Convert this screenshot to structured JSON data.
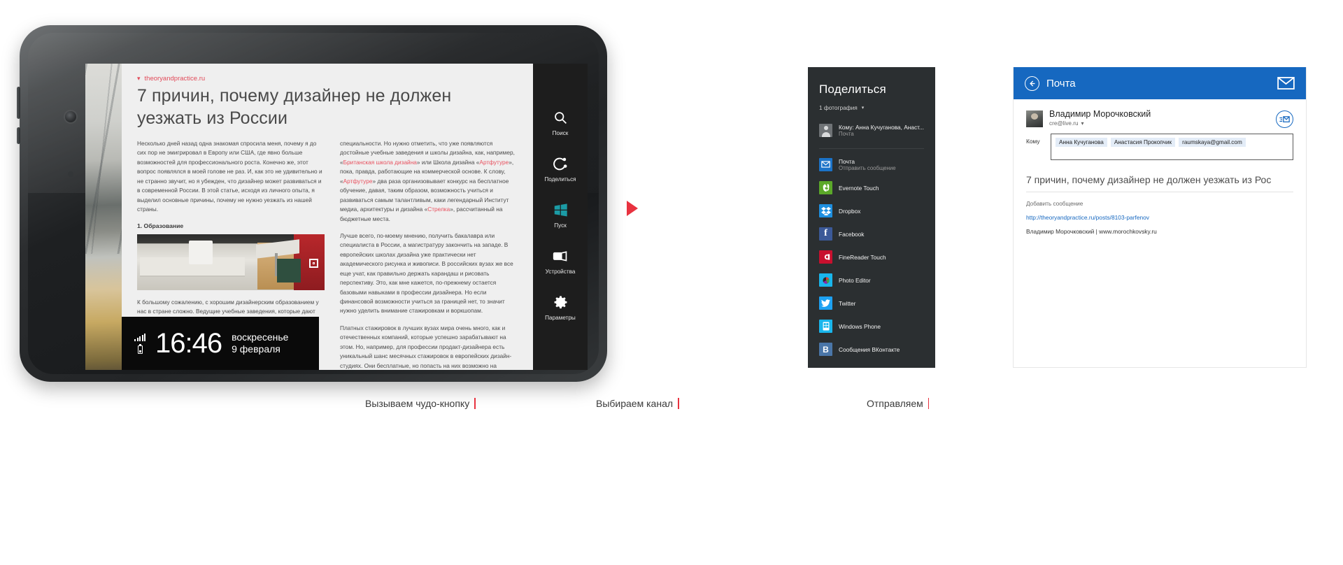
{
  "tablet": {
    "article": {
      "source": "theoryandpractice.ru",
      "title": "7 причин, почему дизайнер не должен уезжать из России",
      "left_column": [
        "Несколько дней назад одна знакомая спросила меня, почему я до сих пор не эмигрировал в Европу или США, где явно больше возможностей для профессионального роста. Конечно же, этот вопрос появлялся в моей голове не раз. И, как это не удивительно и не странно звучит, но я убежден, что дизайнер может развиваться и в современной России. В этой статье, исходя из личного опыта, я выделил основные причины, почему не нужно уезжать из нашей страны.",
        "К большому сожалению, с хорошим дизайнерским образованием у нас в стране сложно. Ведущие учебные заведения, которые дают высшее образование, выпускают не конкурентноспособных профессионалов. Приведу такой удивительный факт: я не знаю ни одного современного российского продакт-дизайнера из тех, чьи имена появляются в прессе,"
      ],
      "section_heading": "1. Образование",
      "right_column": [
        "специальности. Но нужно отметить, что уже появляются достойные учебные заведения и школы дизайна, как, например, «Британская школа дизайна» или Школа дизайна «Артфутуре», пока, правда, работающие на коммерческой основе. К слову, «Артфутуре» два раза организовывает конкурс на бесплатное обучение, давая, таким образом, возможность учиться и развиваться самым талантливым, каки легендарный Институт медиа, архитектуры и дизайна «Стрелка», рассчитанный на бюджетные места.",
        "Лучше всего, по-моему мнению, получить бакалавра или специалиста в России, а магистратуру закончить на западе. В европейских школах дизайна уже практически нет академического рисунка и живописи. В российских вузах же все еще учат, как правильно держать карандаш и рисовать перспективу. Это, как мне кажется, по-прежнему остается базовыми навыками в профессии дизайнера. Но если финансовой возможности учиться за границей нет, то значит нужно уделить внимание стажировкам и воркшопам.",
        "Платных стажировок в лучших вузах мира очень много, как и отечественных компаний, которые успешно зарабатывают на этом. Но, например, для профессии продакт-дизайнера есть уникальный шанс месячных стажировок в европейских дизайн-студиях. Они бесплатные, но попасть на них возможно на конкурсной основе. Приведу такой удивительный факт: я не знаю ни одного современного российского продакт-дизайнера из тех, чьи имена появляются в прессе, а объекты на международных выставках, кто бы закончил кафедры"
      ],
      "highlights": [
        "Британская школа дизайна",
        "Артфутуре",
        "Стрелка"
      ]
    },
    "lock_clock": {
      "time": "16:46",
      "weekday": "воскресенье",
      "date": "9 февраля",
      "signal_icon": "signal-bars-icon",
      "battery_icon": "battery-icon"
    },
    "charms": [
      {
        "label": "Поиск",
        "icon": "search-icon"
      },
      {
        "label": "Поделиться",
        "icon": "share-icon"
      },
      {
        "label": "Пуск",
        "icon": "windows-start-icon"
      },
      {
        "label": "Устройства",
        "icon": "devices-icon"
      },
      {
        "label": "Параметры",
        "icon": "settings-gear-icon"
      }
    ]
  },
  "share_panel": {
    "title": "Поделиться",
    "photo_count": "1 фотография",
    "chevron_icon": "chevron-down-icon",
    "recent": {
      "title": "Кому: Анна Кучуганова, Анаст...",
      "subtitle": "Почта",
      "icon": "contact-avatar-icon"
    },
    "targets": [
      {
        "title": "Почта",
        "subtitle": "Отправить сообщение",
        "icon": "mail-icon",
        "color": "#1b73c8",
        "glyph": "✉"
      },
      {
        "title": "Evernote Touch",
        "subtitle": "",
        "icon": "evernote-icon",
        "color": "#5ba829",
        "glyph": "🐘"
      },
      {
        "title": "Dropbox",
        "subtitle": "",
        "icon": "dropbox-icon",
        "color": "#1e8fe0",
        "glyph": "❖"
      },
      {
        "title": "Facebook",
        "subtitle": "",
        "icon": "facebook-icon",
        "color": "#3b5998",
        "glyph": "f"
      },
      {
        "title": "FineReader Touch",
        "subtitle": "",
        "icon": "finereader-icon",
        "color": "#c8102e",
        "glyph": "C"
      },
      {
        "title": "Photo Editor",
        "subtitle": "",
        "icon": "photo-editor-icon",
        "color": "#19b6ec",
        "glyph": "◉"
      },
      {
        "title": "Twitter",
        "subtitle": "",
        "icon": "twitter-icon",
        "color": "#1da1f2",
        "glyph": "🐦"
      },
      {
        "title": "Windows Phone",
        "subtitle": "",
        "icon": "windows-phone-icon",
        "color": "#19b6ec",
        "glyph": "▦"
      },
      {
        "title": "Сообщения ВКонтакте",
        "subtitle": "",
        "icon": "vkontakte-icon",
        "color": "#4a76a8",
        "glyph": "B"
      }
    ]
  },
  "mail_panel": {
    "header_title": "Почта",
    "back_icon": "back-arrow-icon",
    "envelope_icon": "envelope-icon",
    "send_icon": "send-mail-icon",
    "sender_name": "Владимир Морочковский",
    "sender_email": "cre@live.ru",
    "sender_chevron": "chevron-down-icon",
    "to_label": "Кому",
    "recipients": [
      "Анна Кучуганова",
      "Анастасия Прокопчик",
      "raumskaya@gmail.com"
    ],
    "subject": "7 причин, почему дизайнер не должен уезжать из Рос",
    "message_placeholder": "Добавить сообщение",
    "message_link": "http://theoryandpractice.ru/posts/8103-parfenov",
    "message_signature": "Владимир Морочковский | www.morochkovsky.ru"
  },
  "captions": {
    "step1": "Вызываем чудо-кнопку",
    "step2": "Выбираем канал",
    "step3": "Отправляем"
  },
  "colors": {
    "accent_red": "#e8323f",
    "link_blue": "#1668c0",
    "charm_bg": "#1d1d1d",
    "share_bg": "#2b2f31"
  }
}
